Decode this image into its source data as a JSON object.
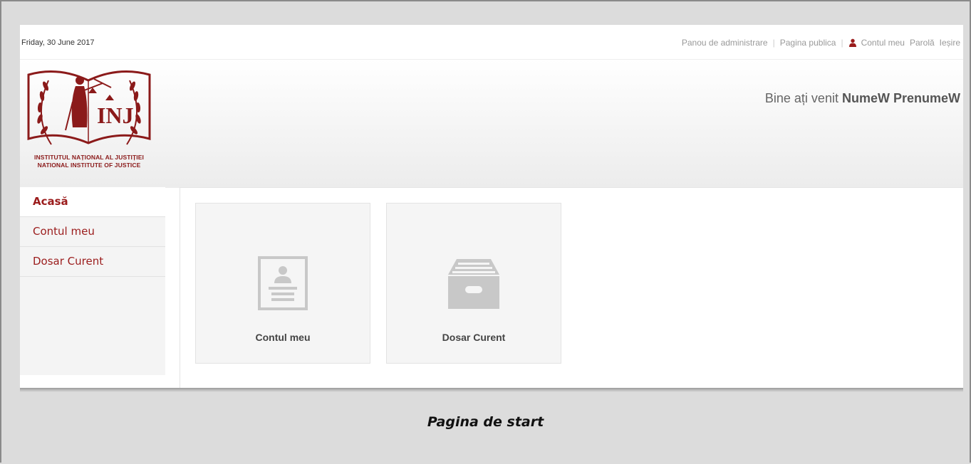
{
  "topbar": {
    "date": "Friday, 30 June 2017",
    "links": {
      "admin": "Panou de administrare",
      "public": "Pagina publica",
      "account": "Contul meu",
      "password": "Parolă",
      "logout": "Ieșire"
    }
  },
  "header": {
    "welcome_prefix": "Bine ați venit",
    "user_name": "NumeW PrenumeW",
    "logo_line1": "INSTITUTUL NAȚIONAL AL JUSTIȚIEI",
    "logo_line2": "NATIONAL INSTITUTE OF JUSTICE",
    "logo_monogram": "INJ"
  },
  "sidebar": {
    "items": [
      {
        "label": "Acasă"
      },
      {
        "label": "Contul meu"
      },
      {
        "label": "Dosar Curent"
      }
    ]
  },
  "tiles": [
    {
      "label": "Contul meu",
      "icon": "profile-card-icon"
    },
    {
      "label": "Dosar Curent",
      "icon": "archive-box-icon"
    }
  ],
  "caption": "Pagina de start",
  "colors": {
    "brand": "#9b1c1c",
    "icon_gray": "#c8c8c8"
  }
}
